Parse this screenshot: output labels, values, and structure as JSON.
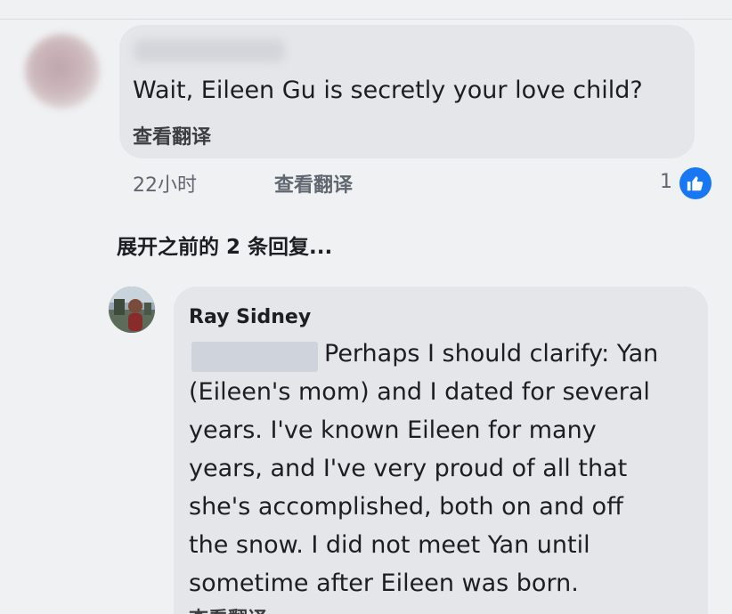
{
  "comment": {
    "text": "Wait, Eileen Gu is secretly your love child?",
    "translate_label": "查看翻译",
    "time": "22小时",
    "meta_translate_label": "查看翻译",
    "like_count": "1"
  },
  "expand_replies": "展开之前的 2 条回复...",
  "reply": {
    "author": "Ray Sidney",
    "lines": [
      "Perhaps I should clarify: Yan",
      "(Eileen's mom) and I dated for several",
      "years. I've known Eileen for many",
      "years, and I've very proud of all that",
      "she's accomplished, both on and off",
      "the snow. I did not meet Yan until",
      "sometime after Eileen was born."
    ],
    "translate_label": "查看翻译"
  },
  "colors": {
    "bubble": "#e4e6ea",
    "background": "#f0f1f3",
    "like_blue": "#1877f2",
    "text": "#1c1e21",
    "meta": "#606770"
  },
  "icons": {
    "like": "thumbs-up-icon"
  }
}
